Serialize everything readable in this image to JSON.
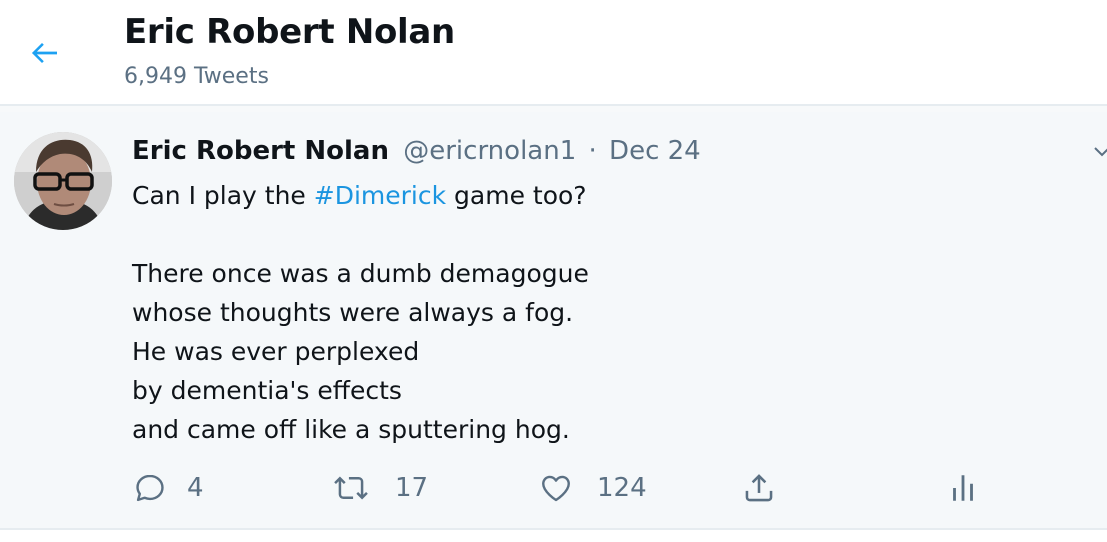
{
  "header": {
    "title": "Eric Robert Nolan",
    "tweet_count": "6,949 Tweets"
  },
  "tweet": {
    "author_name": "Eric Robert Nolan",
    "author_handle": "@ericrnolan1",
    "separator": "·",
    "date": "Dec 24",
    "text": {
      "line1_before": "Can I play the ",
      "hashtag": "#Dimerick",
      "line1_after": " game too?",
      "poem": [
        "There once was a dumb demagogue",
        "whose thoughts were always a fog.",
        "He was ever perplexed",
        "by dementia's effects",
        "and came off like a sputtering hog."
      ]
    },
    "actions": {
      "reply_count": "4",
      "retweet_count": "17",
      "like_count": "124"
    }
  },
  "colors": {
    "accent": "#1da1f2",
    "hashtag": "#1b95e0",
    "secondary_text": "#5b7083",
    "tweet_background": "#f5f8fa"
  },
  "icons": {
    "back": "arrow-left-icon",
    "caret": "chevron-down-icon",
    "reply": "reply-icon",
    "retweet": "retweet-icon",
    "like": "heart-icon",
    "share": "share-icon",
    "analytics": "analytics-icon"
  }
}
